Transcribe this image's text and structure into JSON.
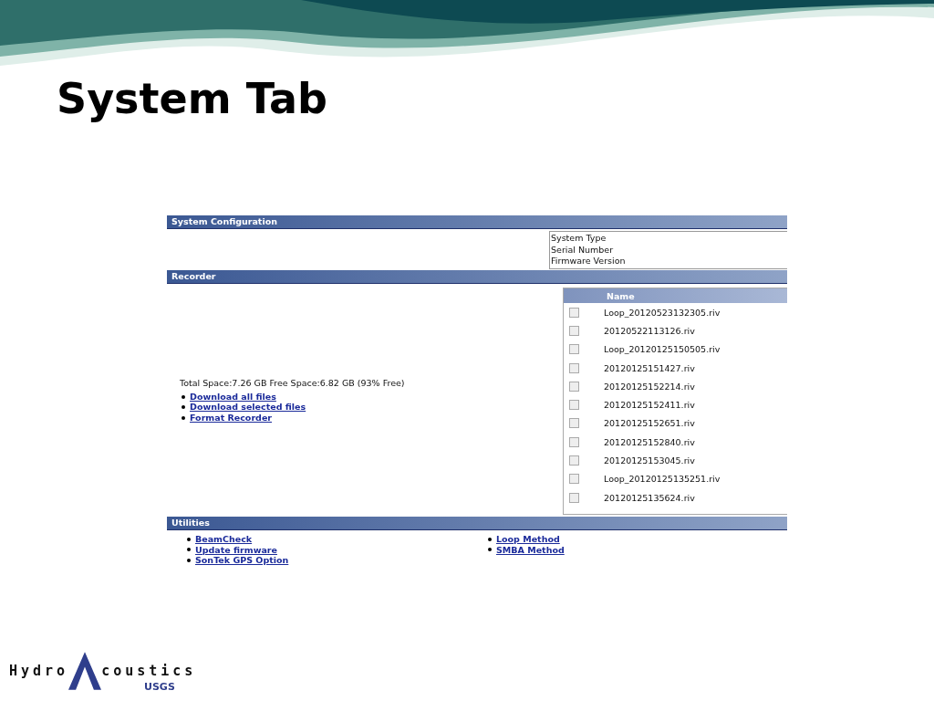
{
  "slide": {
    "title": "System Tab"
  },
  "system_configuration": {
    "header": "System Configuration",
    "fields": [
      "System Type",
      "Serial Number",
      "Firmware Version"
    ]
  },
  "recorder": {
    "header": "Recorder",
    "space": "Total Space:7.26 GB Free Space:6.82 GB (93% Free)",
    "links": [
      "Download all files",
      "Download selected files",
      "Format Recorder"
    ],
    "files": {
      "columns": [
        "Name"
      ],
      "rows": [
        {
          "name": "Loop_20120523132305.riv",
          "checked": false
        },
        {
          "name": "20120522113126.riv",
          "checked": false
        },
        {
          "name": "Loop_20120125150505.riv",
          "checked": false
        },
        {
          "name": "20120125151427.riv",
          "checked": false
        },
        {
          "name": "20120125152214.riv",
          "checked": false
        },
        {
          "name": "20120125152411.riv",
          "checked": false
        },
        {
          "name": "20120125152651.riv",
          "checked": false
        },
        {
          "name": "20120125152840.riv",
          "checked": false
        },
        {
          "name": "20120125153045.riv",
          "checked": false
        },
        {
          "name": "Loop_20120125135251.riv",
          "checked": false
        },
        {
          "name": "20120125135624.riv",
          "checked": false
        }
      ]
    }
  },
  "utilities": {
    "header": "Utilities",
    "left_links": [
      "BeamCheck",
      "Update firmware",
      "SonTek GPS Option"
    ],
    "right_links": [
      "Loop Method",
      "SMBA Method"
    ]
  },
  "logo": {
    "left": "Hydro",
    "right": "coustics",
    "agency": "USGS"
  }
}
